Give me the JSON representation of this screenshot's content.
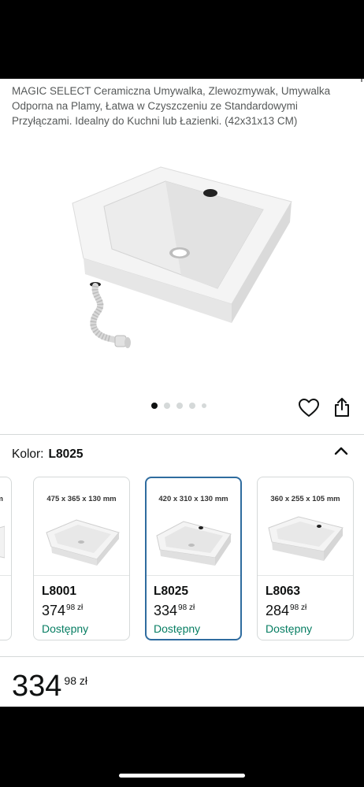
{
  "product": {
    "title": "MAGIC SELECT Ceramiczna Umywalka, Zlewozmywak, Umywalka Odporna na Plamy, Łatwa w Czyszczeniu ze Standardowymi Przyłączami. Idealny do Kuchni lub Łazienki. (42x31x13 CM)"
  },
  "gallery": {
    "image_count": 5,
    "active_index": 0
  },
  "variant": {
    "label": "Kolor:",
    "value": "L8025"
  },
  "cards": [
    {
      "dims": "mm",
      "code": "",
      "price_main": "",
      "price_frac": "",
      "availability": ""
    },
    {
      "dims": "475 x 365 x 130 mm",
      "code": "L8001",
      "price_main": "374",
      "price_frac": "98 zł",
      "availability": "Dostępny"
    },
    {
      "dims": "420 x 310 x 130 mm",
      "code": "L8025",
      "price_main": "334",
      "price_frac": "98 zł",
      "availability": "Dostępny"
    },
    {
      "dims": "360 x 255 x 105 mm",
      "code": "L8063",
      "price_main": "284",
      "price_frac": "98 zł",
      "availability": "Dostępny"
    }
  ],
  "price": {
    "main": "334",
    "frac": "98 zł"
  },
  "icons": {
    "heart": "heart-icon",
    "share": "share-icon",
    "collapse": "chevron-up-icon"
  },
  "colors": {
    "available": "#067d62",
    "selected_border": "#2f6c9f"
  }
}
